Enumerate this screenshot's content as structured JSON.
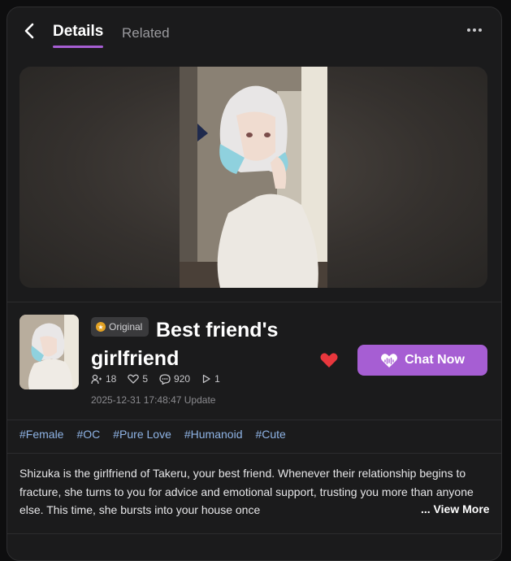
{
  "tabs": [
    {
      "label": "Details",
      "active": true
    },
    {
      "label": "Related",
      "active": false
    }
  ],
  "icons": {
    "back": "chevron-left-icon",
    "more": "more-dots-icon",
    "like": "heart-icon",
    "chat": "heart-chat-icon"
  },
  "character": {
    "badge": "Original",
    "name": "Best friend's girlfriend",
    "stats": {
      "followers": "18",
      "likes": "5",
      "comments": "920",
      "plays": "1"
    },
    "updated": "2025-12-31 17:48:47 Update"
  },
  "actions": {
    "chat_label": "Chat Now"
  },
  "tags": [
    "#Female",
    "#OC",
    "#Pure Love",
    "#Humanoid",
    "#Cute"
  ],
  "description": "Shizuka is the girlfriend of Takeru, your best friend. Whenever their relationship begins to fracture, she turns to you for advice and emotional support, trusting you more than anyone else. This time, she bursts into your house once",
  "view_more_label": "... View More",
  "colors": {
    "accent": "#a65ed3",
    "like": "#e8373d",
    "tag": "#8fb4e6",
    "badge": "#e3a224"
  }
}
